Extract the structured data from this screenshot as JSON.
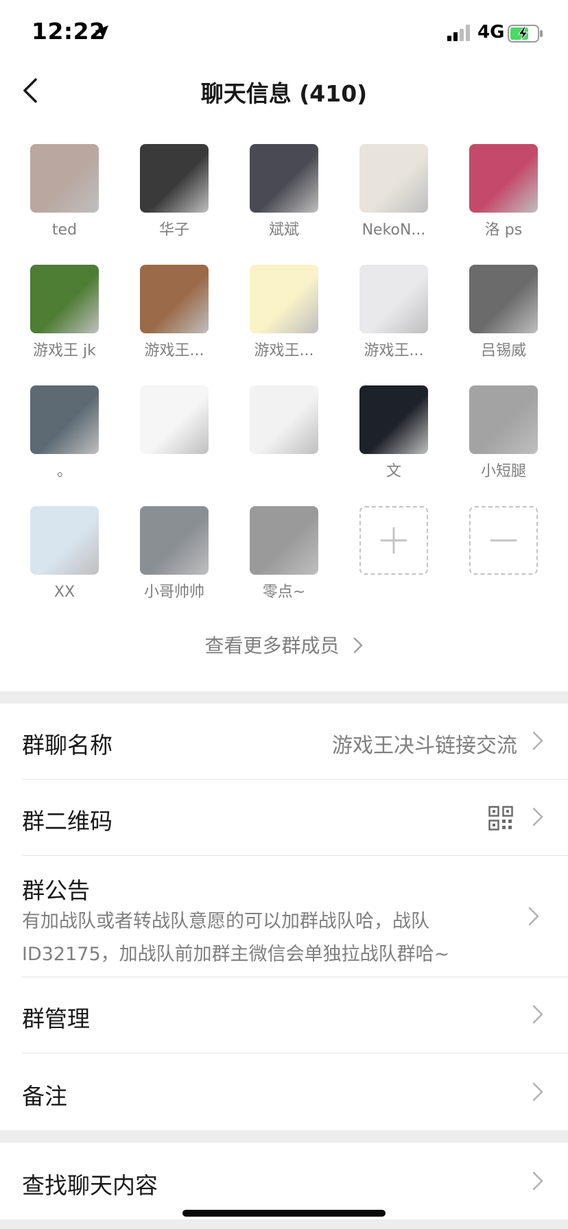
{
  "status_bar": {
    "time": "12:22",
    "network": "4G",
    "icons": [
      "location-arrow-icon",
      "signal-icon",
      "battery-charging-icon"
    ]
  },
  "nav": {
    "title": "聊天信息 (410)",
    "back_icon": "chevron-left-icon"
  },
  "members": [
    {
      "name": "ted",
      "avatar_color": "#b9a7a0"
    },
    {
      "name": "华子",
      "avatar_color": "#3a3a3a"
    },
    {
      "name": "斌斌",
      "avatar_color": "#4a4a52"
    },
    {
      "name": "NekoN...",
      "avatar_color": "#e8e4dc"
    },
    {
      "name": "洛 ps",
      "avatar_color": "#c44a6a"
    },
    {
      "name": "游戏王 jk",
      "avatar_color": "#4e7d34"
    },
    {
      "name": "游戏王...",
      "avatar_color": "#9b6a48"
    },
    {
      "name": "游戏王...",
      "avatar_color": "#fbf3c8"
    },
    {
      "name": "游戏王...",
      "avatar_color": "#e9e9ec"
    },
    {
      "name": "吕锡威",
      "avatar_color": "#6b6b6b"
    },
    {
      "name": "。",
      "avatar_color": "#5d6a74"
    },
    {
      "name": "",
      "avatar_color": "#f6f6f6"
    },
    {
      "name": "",
      "avatar_color": "#f2f2f2"
    },
    {
      "name": "文",
      "avatar_color": "#1d2128"
    },
    {
      "name": "小短腿",
      "avatar_color": "#a3a3a3"
    },
    {
      "name": "XX",
      "avatar_color": "#d9e5ee"
    },
    {
      "name": "小哥帅帅",
      "avatar_color": "#8a8f94"
    },
    {
      "name": "零点~",
      "avatar_color": "#9a9a9a"
    }
  ],
  "actions": {
    "add_icon": "plus-icon",
    "remove_icon": "minus-icon"
  },
  "more_members": "查看更多群成员",
  "settings": {
    "group_name": {
      "label": "群聊名称",
      "value": "游戏王决斗链接交流"
    },
    "qr_code": {
      "label": "群二维码",
      "icon": "qr-code-icon"
    },
    "notice": {
      "label": "群公告",
      "line1": "有加战队或者转战队意愿的可以加群战队哈，战队",
      "line2": "ID32175，加战队前加群主微信会单独拉战队群哈~"
    },
    "manage": {
      "label": "群管理"
    },
    "remark": {
      "label": "备注"
    }
  },
  "search_chat": {
    "label": "查找聊天内容"
  },
  "colors": {
    "background": "#ededed",
    "surface": "#ffffff",
    "primary_text": "#191919",
    "secondary_text": "#7f7f7f",
    "battery_green": "#4cd964"
  }
}
